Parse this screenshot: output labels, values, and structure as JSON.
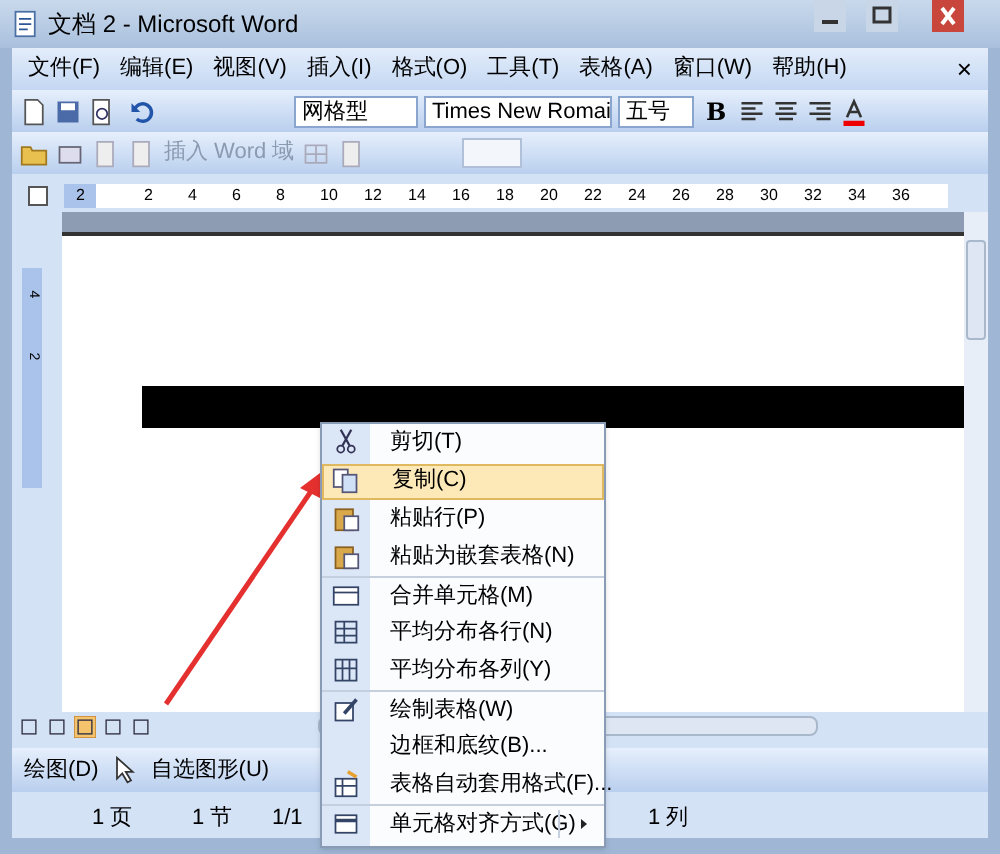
{
  "window": {
    "title": "文档 2 - Microsoft Word"
  },
  "menu_bar": {
    "items": [
      "文件(F)",
      "编辑(E)",
      "视图(V)",
      "插入(I)",
      "格式(O)",
      "工具(T)",
      "表格(A)",
      "窗口(W)",
      "帮助(H)"
    ],
    "close": "×"
  },
  "formatting_toolbar": {
    "style": "网格型",
    "font": "Times New Romai",
    "size": "五号",
    "bold": "B"
  },
  "fields_toolbar": {
    "insert_field": "插入 Word 域"
  },
  "ruler": {
    "marks": [
      "2",
      "2",
      "4",
      "6",
      "8",
      "10",
      "12",
      "14",
      "16",
      "18",
      "20",
      "22",
      "24",
      "26",
      "28",
      "30",
      "32",
      "34",
      "36"
    ]
  },
  "vertical_ruler": {
    "marks": [
      "4",
      "2"
    ]
  },
  "context_menu": {
    "items": [
      {
        "label": "剪切(T)",
        "kind": "cut",
        "selected": false,
        "separator_before": false,
        "submenu": false
      },
      {
        "label": "复制(C)",
        "kind": "copy",
        "selected": true,
        "separator_before": false,
        "submenu": false
      },
      {
        "label": "粘贴行(P)",
        "kind": "paste",
        "selected": false,
        "separator_before": false,
        "submenu": false
      },
      {
        "label": "粘贴为嵌套表格(N)",
        "kind": "paste",
        "selected": false,
        "separator_before": false,
        "submenu": false
      },
      {
        "label": "合并单元格(M)",
        "kind": "merge",
        "selected": false,
        "separator_before": true,
        "submenu": false
      },
      {
        "label": "平均分布各行(N)",
        "kind": "rows",
        "selected": false,
        "separator_before": false,
        "submenu": false
      },
      {
        "label": "平均分布各列(Y)",
        "kind": "cols",
        "selected": false,
        "separator_before": false,
        "submenu": false
      },
      {
        "label": "绘制表格(W)",
        "kind": "draw",
        "selected": false,
        "separator_before": true,
        "submenu": false
      },
      {
        "label": "边框和底纹(B)...",
        "kind": "none",
        "selected": false,
        "separator_before": false,
        "submenu": false
      },
      {
        "label": "表格自动套用格式(F)...",
        "kind": "autoformat",
        "selected": false,
        "separator_before": false,
        "submenu": false
      },
      {
        "label": "单元格对齐方式(G)",
        "kind": "align",
        "selected": false,
        "separator_before": true,
        "submenu": true
      }
    ]
  },
  "drawing_toolbar": {
    "draw": "绘图(D)",
    "autoshapes": "自选图形(U)"
  },
  "status_bar": {
    "items": [
      "1 页",
      "1 节",
      "1/1",
      "1 列"
    ]
  }
}
